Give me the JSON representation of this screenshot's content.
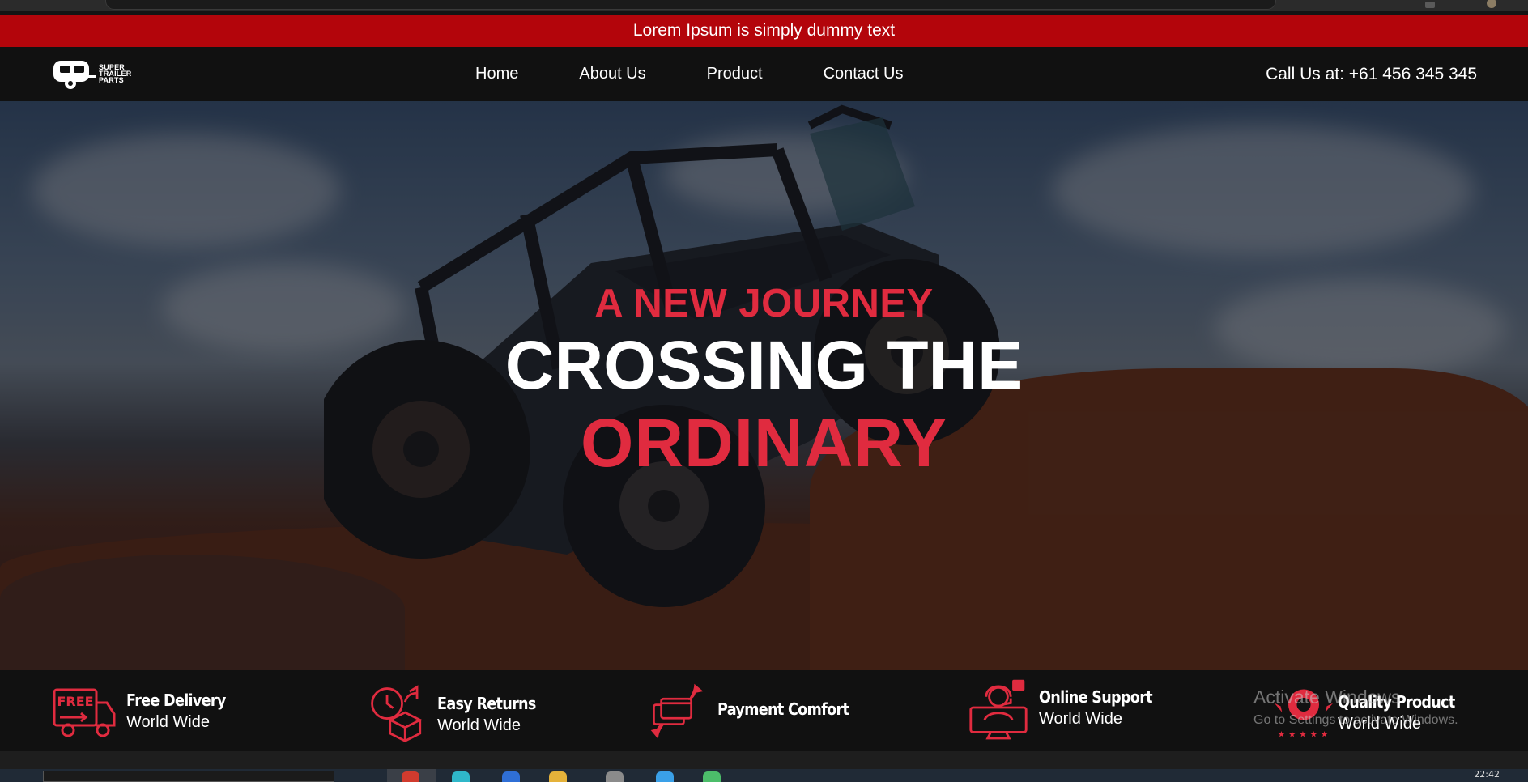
{
  "announcement": {
    "text": "Lorem Ipsum is simply dummy text"
  },
  "logo": {
    "line1": "SUPER",
    "line2": "TRAILER",
    "line3": "PARTS"
  },
  "nav": [
    {
      "label": "Home"
    },
    {
      "label": "About Us"
    },
    {
      "label": "Product"
    },
    {
      "label": "Contact Us"
    }
  ],
  "call": {
    "text": "Call Us at: +61 456 345 345"
  },
  "hero": {
    "kicker": "A NEW JOURNEY",
    "headline": "CROSSING THE",
    "headline_accent": "ORDINARY"
  },
  "features": [
    {
      "title": "Free Delivery",
      "subtitle": "World Wide",
      "icon": "truck-icon",
      "icon_label": "FREE"
    },
    {
      "title": "Easy Returns",
      "subtitle": "World Wide",
      "icon": "box-return-icon"
    },
    {
      "title": "Payment Comfort",
      "subtitle": "",
      "icon": "card-exchange-icon"
    },
    {
      "title": "Online Support",
      "subtitle": "World Wide",
      "icon": "support-agent-icon"
    },
    {
      "title": "Quality Product",
      "subtitle": "World Wide",
      "icon": "quality-badge-icon"
    }
  ],
  "watermark": {
    "line1": "Activate Windows",
    "line2": "Go to Settings to activate Windows."
  },
  "taskbar": {
    "clock": "22:42"
  },
  "colors": {
    "accent": "#e02b3f",
    "announce_bg": "#b3050b",
    "header_bg": "#111111"
  }
}
